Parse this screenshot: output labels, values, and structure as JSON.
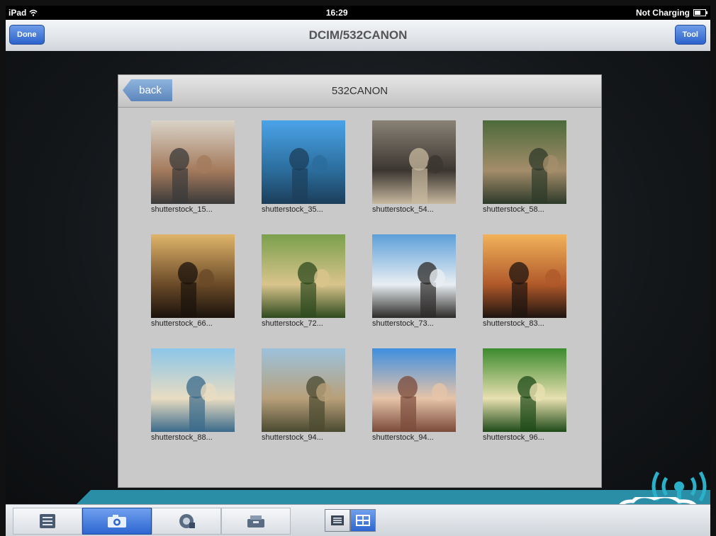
{
  "status": {
    "device": "iPad",
    "time": "16:29",
    "battery_text": "Not Charging"
  },
  "nav": {
    "title": "DCIM/532CANON",
    "done_label": "Done",
    "tool_label": "Tool"
  },
  "panel": {
    "title": "532CANON",
    "back_label": "back"
  },
  "photos": [
    {
      "caption": "shutterstock_15...",
      "palette": [
        "#d9d3c8",
        "#a47a5c",
        "#3a3a3a"
      ]
    },
    {
      "caption": "shutterstock_35...",
      "palette": [
        "#4aa3e8",
        "#2b6d9c",
        "#1c3e5a"
      ]
    },
    {
      "caption": "shutterstock_54...",
      "palette": [
        "#8a8276",
        "#3b3630",
        "#c8b9a0"
      ]
    },
    {
      "caption": "shutterstock_58...",
      "palette": [
        "#4c6a3a",
        "#a48d6a",
        "#2d3a2a"
      ]
    },
    {
      "caption": "shutterstock_66...",
      "palette": [
        "#e0b56a",
        "#6a4a28",
        "#1a120c"
      ]
    },
    {
      "caption": "shutterstock_72...",
      "palette": [
        "#7aa04c",
        "#d9c48c",
        "#2e4a1e"
      ]
    },
    {
      "caption": "shutterstock_73...",
      "palette": [
        "#5d9fd9",
        "#e8eef2",
        "#2c2a28"
      ]
    },
    {
      "caption": "shutterstock_83...",
      "palette": [
        "#f2b25a",
        "#b0592a",
        "#1e1410"
      ]
    },
    {
      "caption": "shutterstock_88...",
      "palette": [
        "#8cc6e8",
        "#e8dcc2",
        "#3a6a8a"
      ]
    },
    {
      "caption": "shutterstock_94...",
      "palette": [
        "#9cc2dc",
        "#b8a07a",
        "#4a4a30"
      ]
    },
    {
      "caption": "shutterstock_94...",
      "palette": [
        "#3e8ee0",
        "#e6c4a8",
        "#7a4a3a"
      ]
    },
    {
      "caption": "shutterstock_96...",
      "palette": [
        "#3c8a2e",
        "#e8e0b0",
        "#1e4a18"
      ]
    }
  ],
  "tabs": [
    {
      "name": "list-tab",
      "icon": "list-icon",
      "active": false
    },
    {
      "name": "camera-tab",
      "icon": "camera-icon",
      "active": true
    },
    {
      "name": "video-tab",
      "icon": "video-camera-icon",
      "active": false
    },
    {
      "name": "music-tab",
      "icon": "music-icon",
      "active": false
    }
  ],
  "view_toggle": [
    {
      "name": "list-view-button",
      "icon": "list-view-icon",
      "active": false
    },
    {
      "name": "grid-view-button",
      "icon": "grid-view-icon",
      "active": true
    }
  ],
  "colors": {
    "accent": "#2d66d0",
    "teal": "#2a8ea6",
    "panel": "#c9c9c9"
  }
}
